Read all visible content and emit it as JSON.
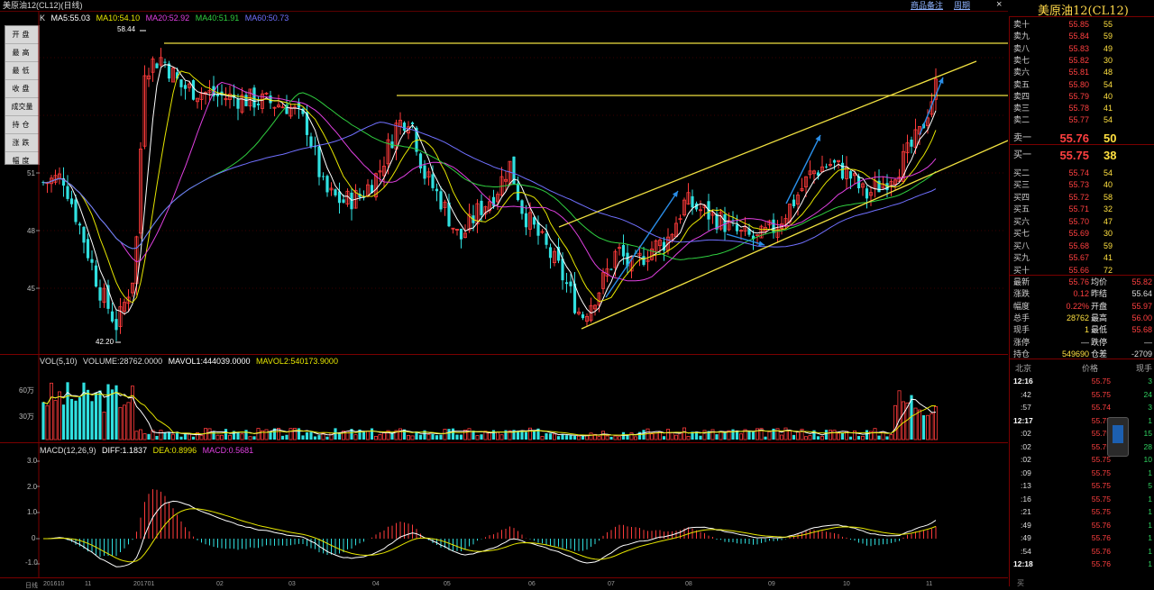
{
  "window": {
    "title": "美原油12(CL12)(日线)",
    "links": [
      "商品备注",
      "周期"
    ],
    "close_glyph": "×"
  },
  "left_menu": [
    "开盘",
    "最高",
    "最低",
    "收盘",
    "成交量",
    "持仓",
    "涨跌",
    "幅度"
  ],
  "main_legend": {
    "k": "K",
    "ma5": "MA5:55.03",
    "ma10": "MA10:54.10",
    "ma20": "MA20:52.92",
    "ma40": "MA40:51.91",
    "ma60": "MA60:50.73"
  },
  "price_axis": [
    "51",
    "48",
    "45"
  ],
  "annotations": {
    "high": "58.44",
    "low": "42.20"
  },
  "volume_legend": {
    "vol": "VOL(5,10)",
    "volume": "VOLUME:28762.0000",
    "mavol1": "MAVOL1:444039.0000",
    "mavol2": "MAVOL2:540173.9000"
  },
  "volume_axis": [
    "60万",
    "30万"
  ],
  "macd_legend": {
    "macd": "MACD(12,26,9)",
    "diff": "DIFF:1.1837",
    "dea": "DEA:0.8996",
    "value": "MACD:0.5681"
  },
  "macd_axis": [
    "3.0",
    "2.0",
    "1.0",
    "0",
    "-1.0"
  ],
  "x_axis": [
    "日线",
    "201610",
    "11",
    "201701",
    "02",
    "03",
    "04",
    "05",
    "06",
    "07",
    "08",
    "09",
    "10",
    "11"
  ],
  "quote": {
    "symbol": "美原油12(CL12)",
    "asks": [
      {
        "label": "卖十",
        "price": "55.85",
        "vol": "55"
      },
      {
        "label": "卖九",
        "price": "55.84",
        "vol": "59"
      },
      {
        "label": "卖八",
        "price": "55.83",
        "vol": "49"
      },
      {
        "label": "卖七",
        "price": "55.82",
        "vol": "30"
      },
      {
        "label": "卖六",
        "price": "55.81",
        "vol": "48"
      },
      {
        "label": "卖五",
        "price": "55.80",
        "vol": "54"
      },
      {
        "label": "卖四",
        "price": "55.79",
        "vol": "40"
      },
      {
        "label": "卖三",
        "price": "55.78",
        "vol": "41"
      },
      {
        "label": "卖二",
        "price": "55.77",
        "vol": "54"
      },
      {
        "label": "卖一",
        "price": "55.76",
        "vol": "50"
      }
    ],
    "bids": [
      {
        "label": "买一",
        "price": "55.75",
        "vol": "38"
      },
      {
        "label": "买二",
        "price": "55.74",
        "vol": "54"
      },
      {
        "label": "买三",
        "price": "55.73",
        "vol": "40"
      },
      {
        "label": "买四",
        "price": "55.72",
        "vol": "58"
      },
      {
        "label": "买五",
        "price": "55.71",
        "vol": "32"
      },
      {
        "label": "买六",
        "price": "55.70",
        "vol": "47"
      },
      {
        "label": "买七",
        "price": "55.69",
        "vol": "30"
      },
      {
        "label": "买八",
        "price": "55.68",
        "vol": "59"
      },
      {
        "label": "买九",
        "price": "55.67",
        "vol": "41"
      },
      {
        "label": "买十",
        "price": "55.66",
        "vol": "72"
      }
    ],
    "stats": [
      {
        "l1": "最新",
        "v1": "55.76",
        "l2": "均价",
        "v2": "55.82"
      },
      {
        "l1": "涨跌",
        "v1": "0.12",
        "l2": "昨结",
        "v2": "55.64"
      },
      {
        "l1": "幅度",
        "v1": "0.22%",
        "l2": "开盘",
        "v2": "55.97"
      },
      {
        "l1": "总手",
        "v1": "28762",
        "l2": "最高",
        "v2": "56.00"
      },
      {
        "l1": "现手",
        "v1": "1",
        "l2": "最低",
        "v2": "55.68"
      },
      {
        "l1": "涨停",
        "v1": "—",
        "l2": "跌停",
        "v2": "—"
      },
      {
        "l1": "持仓",
        "v1": "549690",
        "l2": "仓差",
        "v2": "-2709"
      }
    ],
    "ticks_header": {
      "time": "北京",
      "price": "价格",
      "vol": "现手"
    },
    "ticks": [
      {
        "time": "12:16",
        "price": "55.75",
        "vol": "3"
      },
      {
        "time": ":42",
        "price": "55.75",
        "vol": "24"
      },
      {
        "time": ":57",
        "price": "55.74",
        "vol": "3"
      },
      {
        "time": "12:17",
        "price": "55.75",
        "vol": "1"
      },
      {
        "time": ":02",
        "price": "55.75",
        "vol": "15"
      },
      {
        "time": ":02",
        "price": "55.75",
        "vol": "28"
      },
      {
        "time": ":02",
        "price": "55.75",
        "vol": "10"
      },
      {
        "time": ":09",
        "price": "55.75",
        "vol": "1"
      },
      {
        "time": ":13",
        "price": "55.75",
        "vol": "5"
      },
      {
        "time": ":16",
        "price": "55.75",
        "vol": "1"
      },
      {
        "time": ":21",
        "price": "55.75",
        "vol": "1"
      },
      {
        "time": ":49",
        "price": "55.76",
        "vol": "1"
      },
      {
        "time": ":49",
        "price": "55.76",
        "vol": "1"
      },
      {
        "time": ":54",
        "price": "55.76",
        "vol": "1"
      },
      {
        "time": "12:18",
        "price": "55.76",
        "vol": "1"
      }
    ],
    "footer": "买"
  },
  "colors": {
    "up": "#ff3b3b",
    "down": "#30e0e0",
    "ma5": "#ffffff",
    "ma10": "#e6e600",
    "ma20": "#e040e0",
    "ma40": "#30d040",
    "ma60": "#7070ff",
    "trend": "#f0e040",
    "arrow": "#2a8ee8"
  }
}
